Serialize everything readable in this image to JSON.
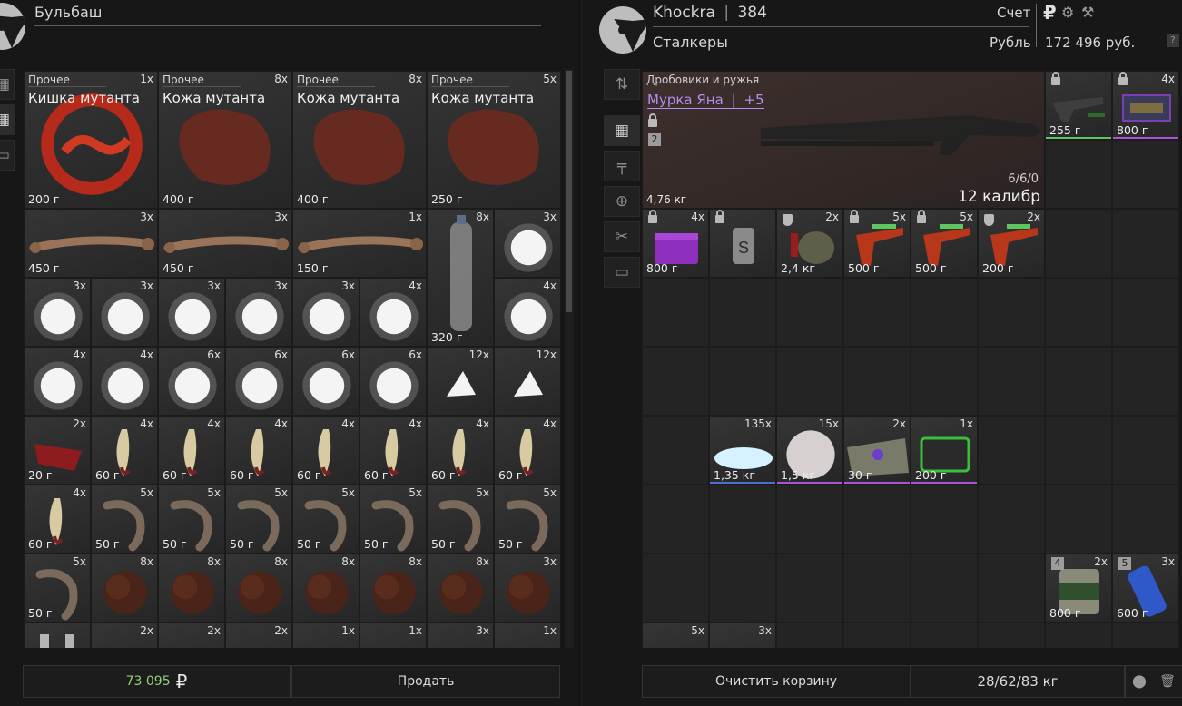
{
  "colors": {
    "accent_purple": "#b88cf0",
    "money_green": "#8cd07c",
    "bar_green": "#5fc65f",
    "bar_purple": "#b04fd8",
    "bar_blue": "#4d70d0"
  },
  "left": {
    "trader_name": "Бульбаш",
    "money": "73 095",
    "currency_symbol": "₽",
    "sell_label": "Продать",
    "items": [
      {
        "category": "Прочее",
        "name": "Кишка мутанта",
        "qty": "1x",
        "weight": "200 г",
        "art": "gut"
      },
      {
        "category": "Прочее",
        "name": "Кожа мутанта",
        "qty": "8x",
        "weight": "400 г",
        "art": "skin"
      },
      {
        "category": "Прочее",
        "name": "Кожа мутанта",
        "qty": "8x",
        "weight": "400 г",
        "art": "skin"
      },
      {
        "category": "Прочее",
        "name": "Кожа мутанта",
        "qty": "5x",
        "weight": "250 г",
        "art": "skin"
      },
      {
        "qty": "3x",
        "weight": "450 г",
        "art": "bone"
      },
      {
        "qty": "3x",
        "weight": "450 г",
        "art": "bone"
      },
      {
        "qty": "1x",
        "weight": "150 г",
        "art": "bone"
      },
      {
        "qty": "8x",
        "weight": "320 г",
        "art": "bottle"
      },
      {
        "qty": "3x",
        "art": "fluff"
      },
      {
        "qty": "3x",
        "art": "fluff"
      },
      {
        "qty": "3x",
        "art": "fluff"
      },
      {
        "qty": "3x",
        "art": "fluff"
      },
      {
        "qty": "3x",
        "art": "fluff"
      },
      {
        "qty": "3x",
        "art": "fluff"
      },
      {
        "qty": "4x",
        "art": "fluff"
      },
      {
        "qty": "4x",
        "art": "fluff"
      },
      {
        "qty": "4x",
        "art": "fluff"
      },
      {
        "qty": "4x",
        "art": "fluff"
      },
      {
        "qty": "6x",
        "art": "fluff"
      },
      {
        "qty": "6x",
        "art": "fluff"
      },
      {
        "qty": "6x",
        "art": "fluff"
      },
      {
        "qty": "6x",
        "art": "fluff"
      },
      {
        "qty": "12x",
        "art": "tooth"
      },
      {
        "qty": "12x",
        "art": "tooth"
      },
      {
        "qty": "2x",
        "weight": "20 г",
        "art": "red"
      },
      {
        "qty": "4x",
        "weight": "60 г",
        "art": "fang"
      },
      {
        "qty": "4x",
        "weight": "60 г",
        "art": "fang"
      },
      {
        "qty": "4x",
        "weight": "60 г",
        "art": "fang"
      },
      {
        "qty": "4x",
        "weight": "60 г",
        "art": "fang"
      },
      {
        "qty": "4x",
        "weight": "60 г",
        "art": "fang"
      },
      {
        "qty": "4x",
        "weight": "60 г",
        "art": "fang"
      },
      {
        "qty": "4x",
        "weight": "60 г",
        "art": "fang"
      },
      {
        "qty": "4x",
        "weight": "60 г",
        "art": "fang"
      },
      {
        "qty": "5x",
        "weight": "50 г",
        "art": "claw"
      },
      {
        "qty": "5x",
        "weight": "50 г",
        "art": "claw"
      },
      {
        "qty": "5x",
        "weight": "50 г",
        "art": "claw"
      },
      {
        "qty": "5x",
        "weight": "50 г",
        "art": "claw"
      },
      {
        "qty": "5x",
        "weight": "50 г",
        "art": "claw"
      },
      {
        "qty": "5x",
        "weight": "50 г",
        "art": "claw"
      },
      {
        "qty": "5x",
        "weight": "50 г",
        "art": "claw"
      },
      {
        "qty": "5x",
        "weight": "50 г",
        "art": "claw"
      },
      {
        "qty": "8x",
        "art": "fur"
      },
      {
        "qty": "8x",
        "art": "fur"
      },
      {
        "qty": "8x",
        "art": "fur"
      },
      {
        "qty": "8x",
        "art": "fur"
      },
      {
        "qty": "8x",
        "art": "fur"
      },
      {
        "qty": "8x",
        "art": "fur"
      },
      {
        "qty": "3x",
        "art": "fur"
      },
      {
        "art": "tool"
      },
      {
        "qty": "2x",
        "art": "green"
      },
      {
        "qty": "2x",
        "art": "green"
      },
      {
        "qty": "2x",
        "art": "green"
      },
      {
        "qty": "1x",
        "art": "green"
      },
      {
        "qty": "1x",
        "art": "cube"
      },
      {
        "qty": "3x",
        "art": "roll"
      },
      {
        "qty": "1x",
        "art": "roll"
      }
    ]
  },
  "right": {
    "player_name": "Khockra",
    "player_level": "384",
    "group": "Сталкеры",
    "account_label": "Счет",
    "currency_label": "Рубль",
    "balance": "172 496 руб.",
    "help_label": "?",
    "weapon": {
      "category": "Дробовики и ружья",
      "name": "Мурка Яна",
      "upgrade": "+5",
      "slot": "2",
      "weight": "4,76 кг",
      "ammo": "6/6/0",
      "caliber": "12 калибр"
    },
    "top_items": [
      {
        "qty": "",
        "weight": "255 г",
        "art": "gun",
        "bar": "green"
      },
      {
        "qty": "4x",
        "weight": "800 г",
        "art": "case",
        "bar": "purple"
      }
    ],
    "row2_items": [
      {
        "qty": "4x",
        "weight": "800 г",
        "art": "purplebox",
        "mark": "lock"
      },
      {
        "qty": "",
        "weight": "",
        "art": "tag",
        "mark": "lock"
      },
      {
        "qty": "2x",
        "weight": "2,4 кг",
        "art": "grenade",
        "mark": "shield"
      },
      {
        "qty": "5x",
        "weight": "500 г",
        "art": "blaster",
        "mark": "lock"
      },
      {
        "qty": "5x",
        "weight": "500 г",
        "art": "blaster",
        "mark": "lock"
      },
      {
        "qty": "2x",
        "weight": "200 г",
        "art": "blaster",
        "mark": "shield"
      }
    ],
    "row5_items": [
      {
        "qty": "135x",
        "weight": "1,35 кг",
        "art": "salt",
        "bar": "blue"
      },
      {
        "qty": "15x",
        "weight": "1,5 кг",
        "art": "cotton",
        "bar": "purple"
      },
      {
        "qty": "2x",
        "weight": "30 г",
        "art": "cloth",
        "bar": "purple"
      },
      {
        "qty": "1x",
        "weight": "200 г",
        "art": "tablet",
        "bar": "purple"
      }
    ],
    "bottom_items": [
      {
        "qty": "2x",
        "weight": "800 г",
        "art": "can",
        "slot": "4"
      },
      {
        "qty": "3x",
        "weight": "600 г",
        "art": "bluecan",
        "slot": "5"
      },
      {
        "qty": "5x",
        "art": "medkit"
      },
      {
        "qty": "3x",
        "art": "medkit"
      }
    ],
    "clear_label": "Очистить корзину",
    "weight_status": "28/62/83 кг"
  }
}
